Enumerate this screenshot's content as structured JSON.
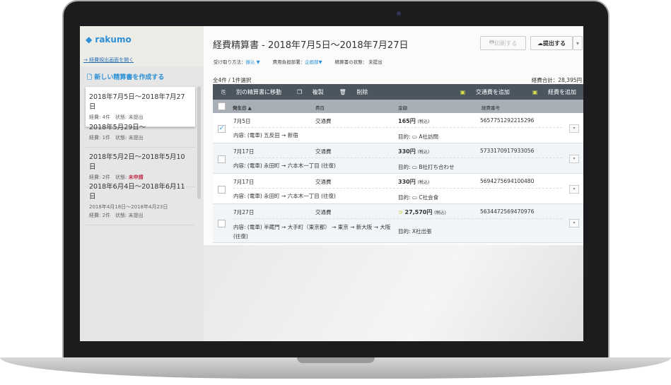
{
  "sidebar": {
    "logo": "rakumo",
    "open_link": "→ 経費規出画面を開く",
    "new_button": "新しい精算書を作成する",
    "reports": [
      {
        "title": "2018年7月5日〜2018年7月27日",
        "sub": "",
        "count": "経費: 4件",
        "status_label": "状態:",
        "status": "未提出"
      },
      {
        "title": "2018年5月29日〜",
        "sub": "",
        "count": "経費: 1件",
        "status_label": "状態:",
        "status": "未提出"
      },
      {
        "title": "2018年5月2日〜2018年5月10日",
        "sub": "",
        "count": "経費: 2件",
        "status_label": "状態:",
        "status": "未申請"
      },
      {
        "title": "2018年6月4日〜2018年6月11日",
        "sub": "2018年4月18日〜2018年4月23日",
        "count": "経費: 2件",
        "status_label": "状態:",
        "status": "未提出"
      }
    ]
  },
  "main": {
    "title": "経費精算書 - 2018年7月5日〜2018年7月27日",
    "print": "印刷する",
    "submit": "提出する",
    "receive_label": "受け取り方法：",
    "receive_value": "振込 ▼",
    "dept_label": "費用負担部署：",
    "dept_value": "企画部▼",
    "state_label": "精算書の状態：",
    "state_value": "未提出",
    "count": "全4件 / 1件選択",
    "total": "経費合計：28,395円",
    "toolbar": {
      "move": "別の精算書に移動",
      "copy": "複製",
      "delete": "削除",
      "add_transport": "交通費を追加",
      "add_expense": "経費を追加"
    },
    "columns": {
      "date": "発生日 ▲",
      "item": "費目",
      "amount": "金額",
      "number": "経費番号"
    },
    "rows": [
      {
        "checked": true,
        "date": "7月5日",
        "item": "交通費",
        "amount": "165円",
        "tax": "(税込)",
        "number": "5657751292215296",
        "content": "内容: (電車) 五反田 → 新宿",
        "purpose": "目的: ▭ A社訪問"
      },
      {
        "checked": false,
        "date": "7月17日",
        "item": "交通費",
        "amount": "330円",
        "tax": "(税込)",
        "number": "5733170917933056",
        "content": "内容: (電車) 永田町 → 六本木一丁目 (往復)",
        "purpose": "目的: ▭ B社打ち合わせ"
      },
      {
        "checked": false,
        "date": "7月17日",
        "item": "交通費",
        "amount": "330円",
        "tax": "(税込)",
        "number": "5694275694100480",
        "content": "内容: (電車) 永田町 → 六本木一丁目 (往復)",
        "purpose": "目的: ▭ C社会食"
      },
      {
        "checked": false,
        "date": "7月27日",
        "item": "交通費",
        "amount": "27,570円",
        "tax": "(税込)",
        "number": "5634472569470976",
        "content": "内容: (電車) 半蔵門 → 大手町（東京都） → 東京 → 新大阪 → 大阪 (往復)",
        "purpose": "目的: X社出張"
      }
    ]
  }
}
